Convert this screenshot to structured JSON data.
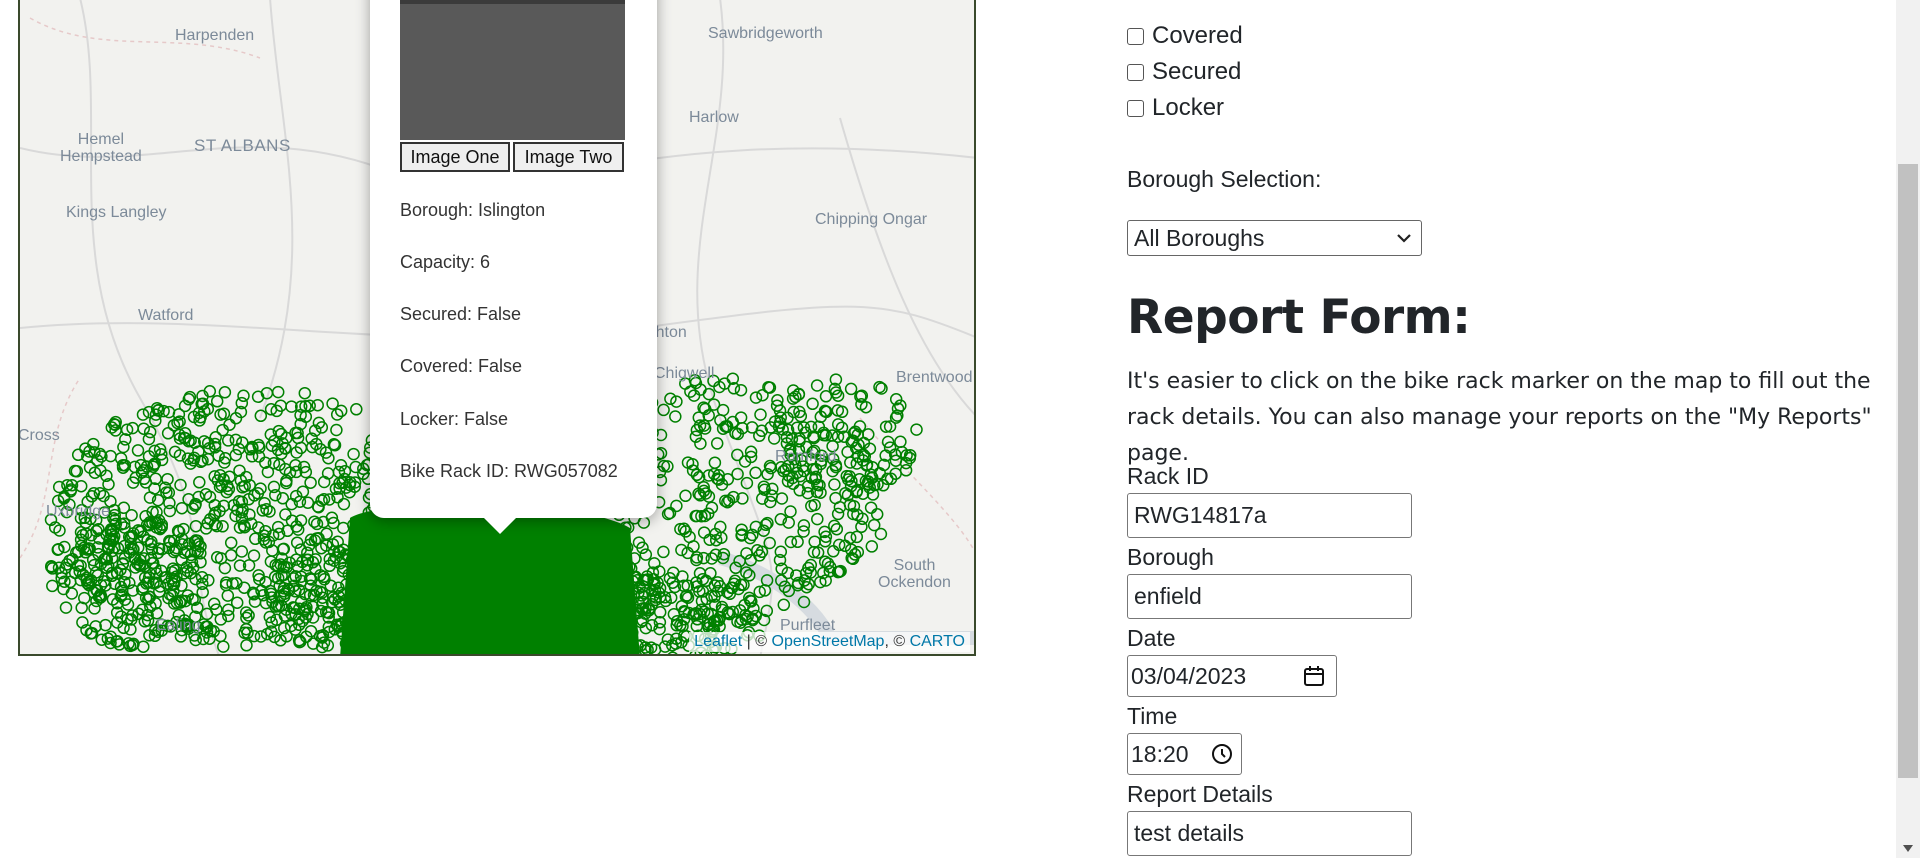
{
  "map": {
    "places": [
      {
        "name": "Harpenden",
        "big": false
      },
      {
        "name": "Sawbridgeworth",
        "big": false
      },
      {
        "name": "Hemel\nHempstead",
        "big": false
      },
      {
        "name": "ST ALBANS",
        "big": true
      },
      {
        "name": "Harlow",
        "big": false
      },
      {
        "name": "Kings Langley",
        "big": false
      },
      {
        "name": "Chipping Ongar",
        "big": false
      },
      {
        "name": "Watford",
        "big": false
      },
      {
        "name": "Loughton",
        "big": false
      },
      {
        "name": "Chigwell",
        "big": false
      },
      {
        "name": "Brentwood",
        "big": false
      },
      {
        "name": "Cross",
        "big": false
      },
      {
        "name": "Uxbridge",
        "big": false
      },
      {
        "name": "Romford",
        "big": false
      },
      {
        "name": "South\nOckendon",
        "big": false
      },
      {
        "name": "Ealing",
        "big": false
      },
      {
        "name": "Purfleet",
        "big": false
      }
    ],
    "attribution": {
      "leaflet": "Leaflet",
      "sep1": " | © ",
      "osm": "OpenStreetMap",
      "sep2": ", © ",
      "carto": "CARTO"
    },
    "marker_color": "#008000"
  },
  "popup": {
    "image_one_label": "Image One",
    "image_two_label": "Image Two",
    "borough": "Borough: Islington",
    "capacity": "Capacity: 6",
    "secured": "Secured: False",
    "covered": "Covered: False",
    "locker": "Locker: False",
    "rack_id": "Bike Rack ID: RWG057082"
  },
  "filters": {
    "covered_label": "Covered",
    "secured_label": "Secured",
    "locker_label": "Locker",
    "borough_selection_label": "Borough Selection:",
    "borough_selected": "All Boroughs"
  },
  "report_form": {
    "title": "Report Form:",
    "intro": "It's easier to click on the bike rack marker on the map to fill out the rack details. You can also manage your reports on the \"My Reports\" page.",
    "rack_id_label": "Rack ID",
    "rack_id_value": "RWG14817a",
    "borough_label": "Borough",
    "borough_value": "enfield",
    "date_label": "Date",
    "date_value": "03/04/2023",
    "time_label": "Time",
    "time_value": "18:20",
    "details_label": "Report Details",
    "details_value": "test details"
  }
}
